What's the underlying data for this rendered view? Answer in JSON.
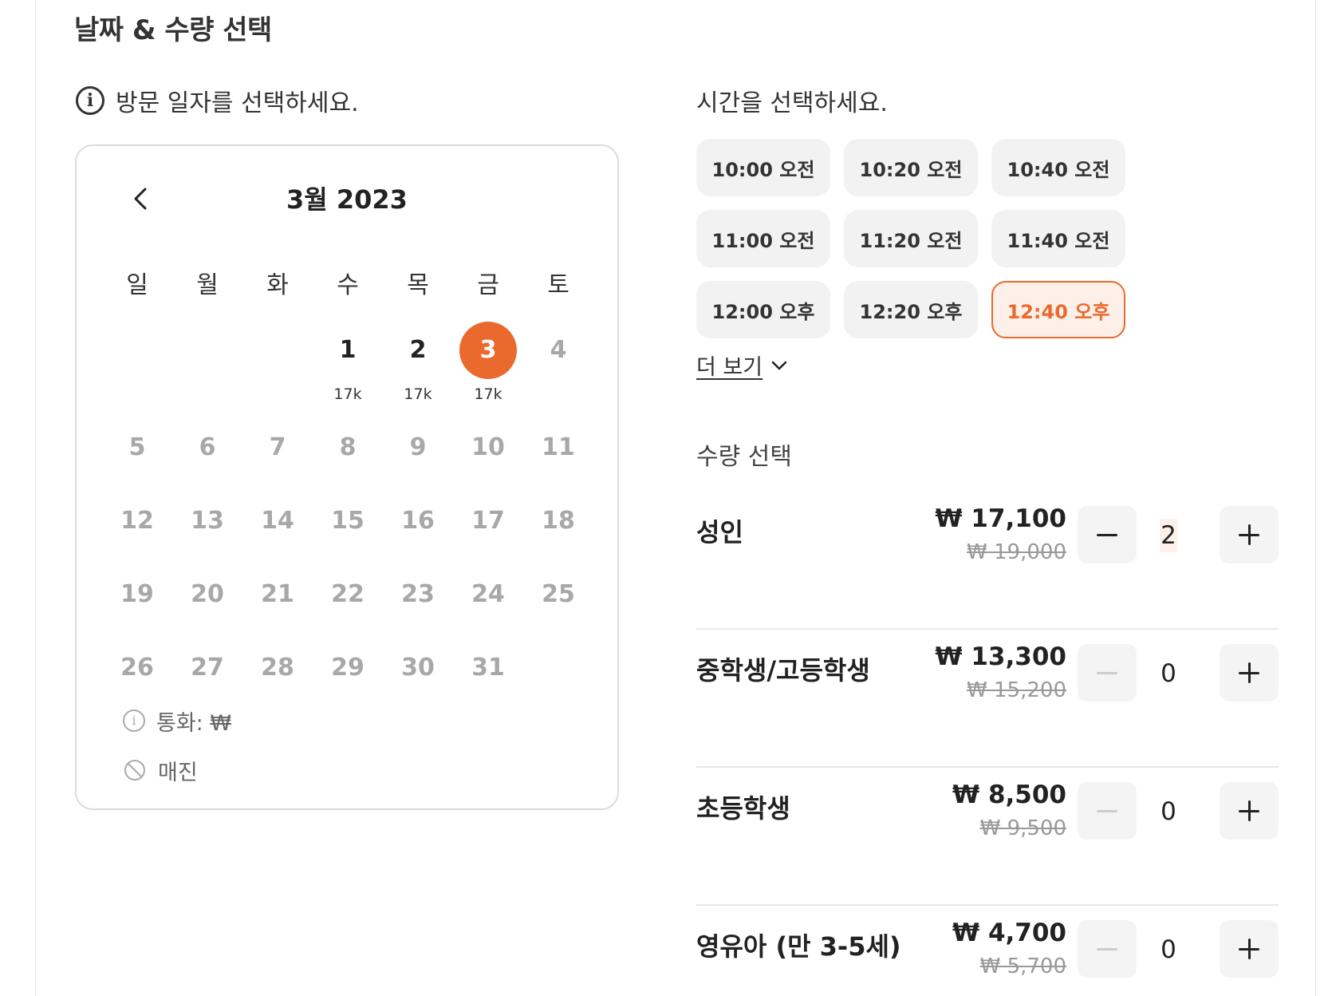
{
  "section_title": "날짜 & 수량 선택",
  "date_prompt": "방문 일자를 선택하세요.",
  "calendar": {
    "title": "3월 2023",
    "weekdays": [
      "일",
      "월",
      "화",
      "수",
      "목",
      "금",
      "토"
    ],
    "weeks": [
      [
        {
          "day": "",
          "price": ""
        },
        {
          "day": "",
          "price": ""
        },
        {
          "day": "",
          "price": ""
        },
        {
          "day": "1",
          "price": "17k",
          "status": "available"
        },
        {
          "day": "2",
          "price": "17k",
          "status": "available"
        },
        {
          "day": "3",
          "price": "17k",
          "status": "selected"
        },
        {
          "day": "4",
          "price": "",
          "status": "disabled"
        }
      ],
      [
        {
          "day": "5",
          "status": "disabled"
        },
        {
          "day": "6",
          "status": "disabled"
        },
        {
          "day": "7",
          "status": "disabled"
        },
        {
          "day": "8",
          "status": "disabled"
        },
        {
          "day": "9",
          "status": "disabled"
        },
        {
          "day": "10",
          "status": "disabled"
        },
        {
          "day": "11",
          "status": "disabled"
        }
      ],
      [
        {
          "day": "12",
          "status": "disabled"
        },
        {
          "day": "13",
          "status": "disabled"
        },
        {
          "day": "14",
          "status": "disabled"
        },
        {
          "day": "15",
          "status": "disabled"
        },
        {
          "day": "16",
          "status": "disabled"
        },
        {
          "day": "17",
          "status": "disabled"
        },
        {
          "day": "18",
          "status": "disabled"
        }
      ],
      [
        {
          "day": "19",
          "status": "disabled"
        },
        {
          "day": "20",
          "status": "disabled"
        },
        {
          "day": "21",
          "status": "disabled"
        },
        {
          "day": "22",
          "status": "disabled"
        },
        {
          "day": "23",
          "status": "disabled"
        },
        {
          "day": "24",
          "status": "disabled"
        },
        {
          "day": "25",
          "status": "disabled"
        }
      ],
      [
        {
          "day": "26",
          "status": "disabled"
        },
        {
          "day": "27",
          "status": "disabled"
        },
        {
          "day": "28",
          "status": "disabled"
        },
        {
          "day": "29",
          "status": "disabled"
        },
        {
          "day": "30",
          "status": "disabled"
        },
        {
          "day": "31",
          "status": "disabled"
        },
        {
          "day": "",
          "status": "empty"
        }
      ]
    ],
    "legend": {
      "currency_label": "통화:",
      "currency_symbol": "₩",
      "soldout_label": "매진"
    }
  },
  "time_prompt": "시간을 선택하세요.",
  "time_slots": [
    {
      "label": "10:00 오전",
      "selected": false
    },
    {
      "label": "10:20 오전",
      "selected": false
    },
    {
      "label": "10:40 오전",
      "selected": false
    },
    {
      "label": "11:00 오전",
      "selected": false
    },
    {
      "label": "11:20 오전",
      "selected": false
    },
    {
      "label": "11:40 오전",
      "selected": false
    },
    {
      "label": "12:00 오후",
      "selected": false
    },
    {
      "label": "12:20 오후",
      "selected": false
    },
    {
      "label": "12:40 오후",
      "selected": true
    }
  ],
  "show_more": "더 보기",
  "quantity_title": "수량 선택",
  "tickets": [
    {
      "name": "성인",
      "price": "₩ 17,100",
      "original_price": "₩ 19,000",
      "quantity": "2",
      "minus_enabled": true
    },
    {
      "name": "중학생/고등학생",
      "price": "₩ 13,300",
      "original_price": "₩ 15,200",
      "quantity": "0",
      "minus_enabled": false
    },
    {
      "name": "초등학생",
      "price": "₩ 8,500",
      "original_price": "₩ 9,500",
      "quantity": "0",
      "minus_enabled": false
    },
    {
      "name": "영유아 (만 3-5세)",
      "price": "₩ 4,700",
      "original_price": "₩ 5,700",
      "quantity": "0",
      "minus_enabled": false
    }
  ],
  "colors": {
    "accent": "#ea6a2e",
    "accent_bg": "#fdf0e9",
    "button_bg": "#f2f2f2",
    "disabled_text": "#a8a8a8"
  }
}
